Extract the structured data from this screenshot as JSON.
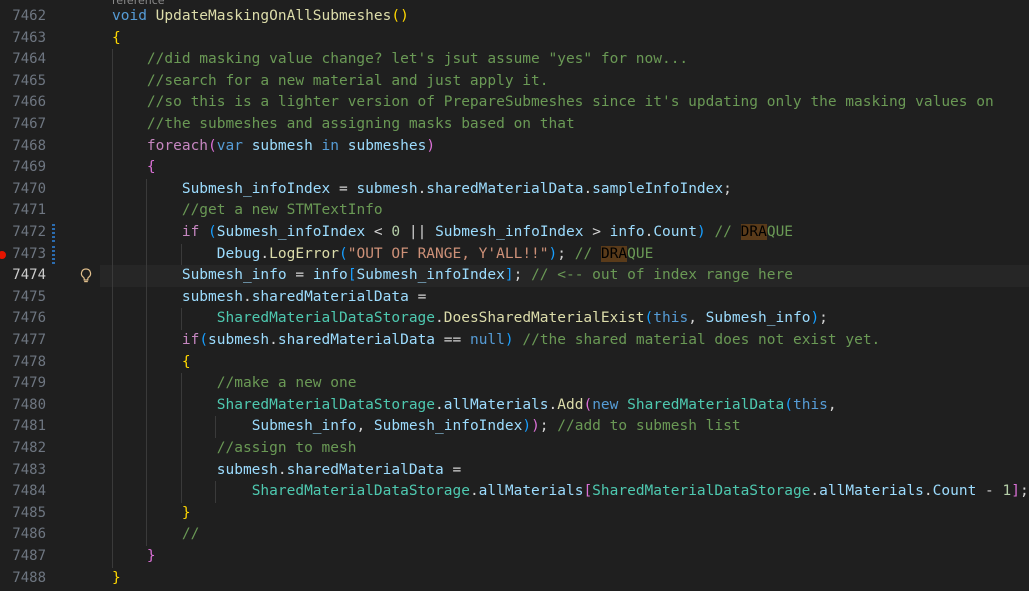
{
  "editor": {
    "codelens_hint": "reference",
    "active_line": 7474,
    "lines": [
      {
        "num": "7462",
        "tokens": [
          [
            "k",
            "void "
          ],
          [
            "f",
            "UpdateMaskingOnAllSubmeshes"
          ],
          [
            "y",
            "()"
          ]
        ]
      },
      {
        "num": "7463",
        "tokens": [
          [
            "y",
            "{"
          ]
        ]
      },
      {
        "num": "7464",
        "tokens": [
          [
            "w",
            "    "
          ],
          [
            "g",
            "//did masking value change? let's jsut assume \"yes\" for now..."
          ]
        ]
      },
      {
        "num": "7465",
        "tokens": [
          [
            "w",
            "    "
          ],
          [
            "g",
            "//search for a new material and just apply it."
          ]
        ]
      },
      {
        "num": "7466",
        "tokens": [
          [
            "w",
            "    "
          ],
          [
            "g",
            "//so this is a lighter version of PrepareSubmeshes since it's updating only the masking values on"
          ]
        ]
      },
      {
        "num": "7467",
        "tokens": [
          [
            "w",
            "    "
          ],
          [
            "g",
            "//the submeshes and assigning masks based on that"
          ]
        ]
      },
      {
        "num": "7468",
        "tokens": [
          [
            "w",
            "    "
          ],
          [
            "c",
            "foreach"
          ],
          [
            "p",
            "("
          ],
          [
            "k",
            "var "
          ],
          [
            "v",
            "submesh "
          ],
          [
            "k",
            "in "
          ],
          [
            "v",
            "submeshes"
          ],
          [
            "p",
            ")"
          ]
        ]
      },
      {
        "num": "7469",
        "tokens": [
          [
            "w",
            "    "
          ],
          [
            "p",
            "{"
          ]
        ]
      },
      {
        "num": "7470",
        "tokens": [
          [
            "w",
            "        "
          ],
          [
            "v",
            "Submesh_infoIndex "
          ],
          [
            "w",
            "= "
          ],
          [
            "v",
            "submesh"
          ],
          [
            "w",
            "."
          ],
          [
            "v",
            "sharedMaterialData"
          ],
          [
            "w",
            "."
          ],
          [
            "v",
            "sampleInfoIndex"
          ],
          [
            "w",
            ";"
          ]
        ]
      },
      {
        "num": "7471",
        "tokens": [
          [
            "w",
            "        "
          ],
          [
            "g",
            "//get a new STMTextInfo"
          ]
        ]
      },
      {
        "num": "7472",
        "tokens": [
          [
            "w",
            "        "
          ],
          [
            "c",
            "if "
          ],
          [
            "b",
            "("
          ],
          [
            "v",
            "Submesh_infoIndex "
          ],
          [
            "w",
            "< "
          ],
          [
            "n",
            "0 "
          ],
          [
            "w",
            "|| "
          ],
          [
            "v",
            "Submesh_infoIndex "
          ],
          [
            "w",
            "> "
          ],
          [
            "v",
            "info"
          ],
          [
            "w",
            "."
          ],
          [
            "v",
            "Count"
          ],
          [
            "b",
            ")"
          ],
          [
            "g",
            " // "
          ],
          [
            "hl",
            "DRA"
          ],
          [
            "g",
            "QUE"
          ]
        ]
      },
      {
        "num": "7473",
        "tokens": [
          [
            "w",
            "            "
          ],
          [
            "v",
            "Debug"
          ],
          [
            "w",
            "."
          ],
          [
            "f",
            "LogError"
          ],
          [
            "b",
            "("
          ],
          [
            "s",
            "\"OUT OF RANGE, Y'ALL!!\""
          ],
          [
            "b",
            ")"
          ],
          [
            "w",
            "; "
          ],
          [
            "g",
            "// "
          ],
          [
            "hl",
            "DRA"
          ],
          [
            "g",
            "QUE"
          ]
        ]
      },
      {
        "num": "7474",
        "tokens": [
          [
            "w",
            "        "
          ],
          [
            "v",
            "Submesh_info "
          ],
          [
            "w",
            "= "
          ],
          [
            "v",
            "info"
          ],
          [
            "b",
            "["
          ],
          [
            "v",
            "Submesh_infoIndex"
          ],
          [
            "b",
            "]"
          ],
          [
            "w",
            "; "
          ],
          [
            "g",
            "// <-- out of index range here"
          ]
        ]
      },
      {
        "num": "7475",
        "tokens": [
          [
            "w",
            "        "
          ],
          [
            "v",
            "submesh"
          ],
          [
            "w",
            "."
          ],
          [
            "v",
            "sharedMaterialData "
          ],
          [
            "w",
            "="
          ]
        ]
      },
      {
        "num": "7476",
        "tokens": [
          [
            "w",
            "            "
          ],
          [
            "t",
            "SharedMaterialDataStorage"
          ],
          [
            "w",
            "."
          ],
          [
            "f",
            "DoesSharedMaterialExist"
          ],
          [
            "b",
            "("
          ],
          [
            "k",
            "this"
          ],
          [
            "w",
            ", "
          ],
          [
            "v",
            "Submesh_info"
          ],
          [
            "b",
            ")"
          ],
          [
            "w",
            ";"
          ]
        ]
      },
      {
        "num": "7477",
        "tokens": [
          [
            "w",
            "        "
          ],
          [
            "c",
            "if"
          ],
          [
            "b",
            "("
          ],
          [
            "v",
            "submesh"
          ],
          [
            "w",
            "."
          ],
          [
            "v",
            "sharedMaterialData "
          ],
          [
            "w",
            "== "
          ],
          [
            "k",
            "null"
          ],
          [
            "b",
            ")"
          ],
          [
            "g",
            " //the shared material does not exist yet."
          ]
        ]
      },
      {
        "num": "7478",
        "tokens": [
          [
            "w",
            "        "
          ],
          [
            "y",
            "{"
          ]
        ]
      },
      {
        "num": "7479",
        "tokens": [
          [
            "w",
            "            "
          ],
          [
            "g",
            "//make a new one"
          ]
        ]
      },
      {
        "num": "7480",
        "tokens": [
          [
            "w",
            "            "
          ],
          [
            "t",
            "SharedMaterialDataStorage"
          ],
          [
            "w",
            "."
          ],
          [
            "v",
            "allMaterials"
          ],
          [
            "w",
            "."
          ],
          [
            "f",
            "Add"
          ],
          [
            "p",
            "("
          ],
          [
            "k",
            "new "
          ],
          [
            "t",
            "SharedMaterialData"
          ],
          [
            "b",
            "("
          ],
          [
            "k",
            "this"
          ],
          [
            "w",
            ","
          ]
        ]
      },
      {
        "num": "7481",
        "tokens": [
          [
            "w",
            "                "
          ],
          [
            "v",
            "Submesh_info"
          ],
          [
            "w",
            ", "
          ],
          [
            "v",
            "Submesh_infoIndex"
          ],
          [
            "b",
            ")"
          ],
          [
            "p",
            ")"
          ],
          [
            "w",
            "; "
          ],
          [
            "g",
            "//add to submesh list"
          ]
        ]
      },
      {
        "num": "7482",
        "tokens": [
          [
            "w",
            "            "
          ],
          [
            "g",
            "//assign to mesh"
          ]
        ]
      },
      {
        "num": "7483",
        "tokens": [
          [
            "w",
            "            "
          ],
          [
            "v",
            "submesh"
          ],
          [
            "w",
            "."
          ],
          [
            "v",
            "sharedMaterialData "
          ],
          [
            "w",
            "="
          ]
        ]
      },
      {
        "num": "7484",
        "tokens": [
          [
            "w",
            "                "
          ],
          [
            "t",
            "SharedMaterialDataStorage"
          ],
          [
            "w",
            "."
          ],
          [
            "v",
            "allMaterials"
          ],
          [
            "p",
            "["
          ],
          [
            "t",
            "SharedMaterialDataStorage"
          ],
          [
            "w",
            "."
          ],
          [
            "v",
            "allMaterials"
          ],
          [
            "w",
            "."
          ],
          [
            "v",
            "Count "
          ],
          [
            "w",
            "- "
          ],
          [
            "n",
            "1"
          ],
          [
            "p",
            "]"
          ],
          [
            "w",
            ";"
          ]
        ]
      },
      {
        "num": "7485",
        "tokens": [
          [
            "w",
            "        "
          ],
          [
            "y",
            "}"
          ]
        ]
      },
      {
        "num": "7486",
        "tokens": [
          [
            "w",
            "        "
          ],
          [
            "g",
            "//"
          ]
        ]
      },
      {
        "num": "7487",
        "tokens": [
          [
            "w",
            "    "
          ],
          [
            "p",
            "}"
          ]
        ]
      },
      {
        "num": "7488",
        "tokens": [
          [
            "y",
            "}"
          ]
        ]
      }
    ]
  }
}
